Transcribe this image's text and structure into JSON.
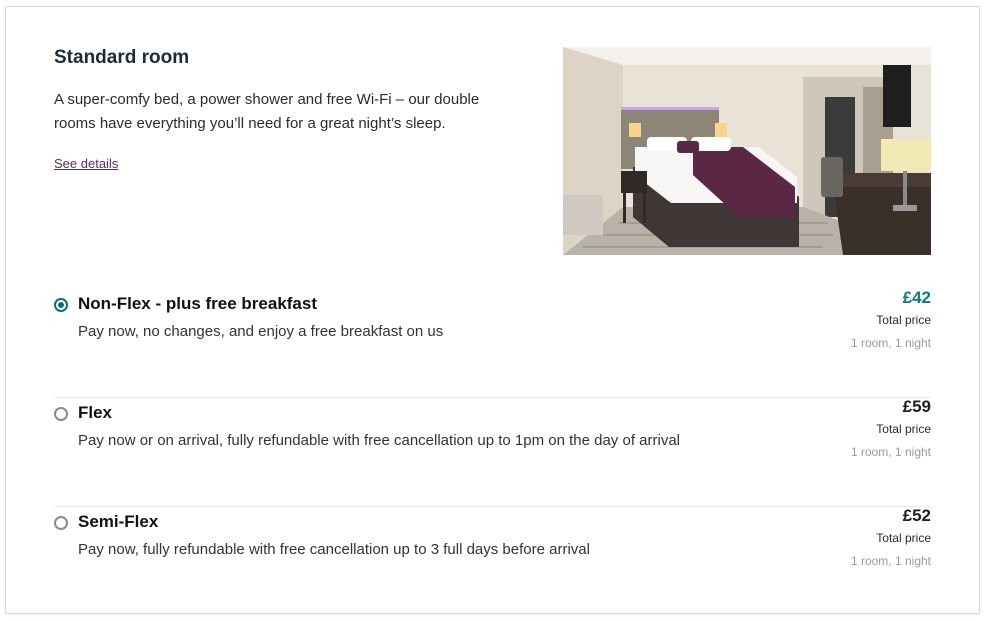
{
  "room": {
    "title": "Standard room",
    "description": "A super-comfy bed, a power shower and free Wi-Fi – our double rooms have everything you’ll need for a great night’s sleep.",
    "details_link": "See details",
    "image_alt": "Standard double room photo"
  },
  "rates": [
    {
      "name": "Non-Flex - plus free breakfast",
      "description": "Pay now, no changes, and enjoy a free breakfast on us",
      "price": "£42",
      "total_label": "Total price",
      "room_night": "1 room, 1 night",
      "selected": true
    },
    {
      "name": "Flex",
      "description": "Pay now or on arrival, fully refundable with free cancellation up to 1pm on the day of arrival",
      "price": "£59",
      "total_label": "Total price",
      "room_night": "1 room, 1 night",
      "selected": false
    },
    {
      "name": "Semi-Flex",
      "description": "Pay now, fully refundable with free cancellation up to 3 full days before arrival",
      "price": "£52",
      "total_label": "Total price",
      "room_night": "1 room, 1 night",
      "selected": false
    }
  ],
  "colors": {
    "accent": "#0b6e78",
    "selected_price": "#0b7a86",
    "link": "#5b2b5c",
    "bed_throw": "#5a2745"
  }
}
